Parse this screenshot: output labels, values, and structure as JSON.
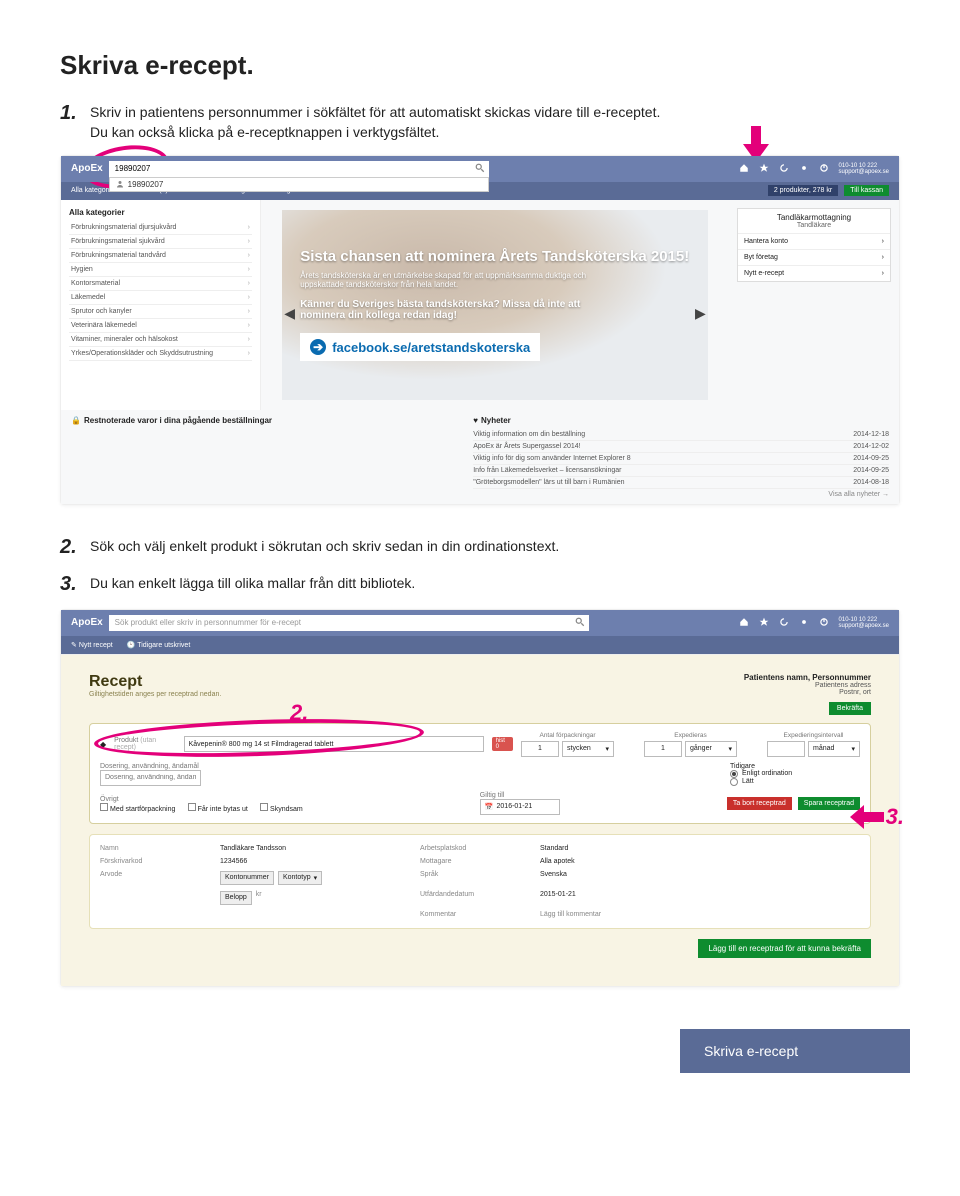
{
  "title": "Skriva e-recept.",
  "step1": {
    "num": "1.",
    "text1": "Skriv in patientens personnummer i sökfältet för att automatiskt skickas vidare till e-receptet.",
    "text2": "Du kan också klicka på e-receptknappen i verktygsfältet."
  },
  "step2": {
    "num": "2.",
    "text": "Sök och välj enkelt produkt i sökrutan och skriv sedan in din ordinationstext."
  },
  "step3": {
    "num": "3.",
    "text": "Du kan enkelt lägga till olika mallar från ditt bibliotek."
  },
  "shot1": {
    "logo": "ApoEx",
    "search_value": "19890207",
    "dropdown_value": "19890207",
    "contact_phone": "010-10 10 222",
    "contact_email": "support@apoex.se",
    "subbar_items": [
      "Alla kategorier",
      "Favoriter (0)",
      "Utlevererat",
      "Tidigare beställningar"
    ],
    "cart_text": "2 produkter, 278 kr",
    "cart_btn": "Till kassan",
    "cat_title": "Alla kategorier",
    "cats": [
      "Förbrukningsmaterial djursjukvård",
      "Förbrukningsmaterial sjukvård",
      "Förbrukningsmaterial tandvård",
      "Hygien",
      "Kontorsmaterial",
      "Läkemedel",
      "Sprutor och kanyler",
      "Veterinära läkemedel",
      "Vitaminer, mineraler och hälsokost",
      "Yrkes/Operationskläder och Skyddsutrustning"
    ],
    "hero_h1": "Sista chansen att nominera Årets Tandsköterska 2015!",
    "hero_p1": "Årets tandsköterska är en utmärkelse skapad för att uppmärksamma duktiga och uppskattade tandsköterskor från hela landet.",
    "hero_sub": "Känner du Sveriges bästa tandsköterska? Missa då inte att nominera din kollega redan idag!",
    "hero_fb": "facebook.se/aretstandskoterska",
    "r_title": "Tandläkarmottagning",
    "r_sub": "Tandläkare",
    "r_rows": [
      "Hantera konto",
      "Byt företag",
      "Nytt e-recept"
    ],
    "bsec_l_title": "Restnoterade varor i dina pågående beställningar",
    "bsec_r_title": "Nyheter",
    "news": [
      {
        "t": "Viktig information om din beställning",
        "d": "2014-12-18"
      },
      {
        "t": "ApoEx är Årets Supergassel 2014!",
        "d": "2014-12-02"
      },
      {
        "t": "Viktig info för dig som använder Internet Explorer 8",
        "d": "2014-09-25"
      },
      {
        "t": "Info från Läkemedelsverket – licensansökningar",
        "d": "2014-09-25"
      },
      {
        "t": "\"Gröteborgsmodellen\" lärs ut till barn i Rumänien",
        "d": "2014-08-18"
      }
    ],
    "news_link": "Visa alla nyheter →"
  },
  "shot2": {
    "logo": "ApoEx",
    "search_placeholder": "Sök produkt eller skriv in personnummer för e-recept",
    "contact_phone": "010-10 10 222",
    "contact_email": "support@apoex.se",
    "subbar_items": [
      "Nytt recept",
      "Tidigare utskrivet"
    ],
    "recept_title": "Recept",
    "recept_sub": "Giltighetstiden anges per receptrad nedan.",
    "patient_name": "Patientens namn, Personnummer",
    "patient_addr": "Patientens adress",
    "patient_post": "Postnr, ort",
    "bekr": "Bekräfta",
    "prod_label": "Produkt",
    "prod_sub": "(utan recept)",
    "prod_value": "Kåvepenin® 800 mg 14 st Filmdragerad tablett",
    "pill": "hist 0",
    "mid_cols": [
      {
        "lab": "Antal förpackningar",
        "val": "1",
        "unit": "stycken"
      },
      {
        "lab": "Expedieras",
        "val": "1",
        "unit": "gånger"
      },
      {
        "lab": "Expedieringsintervall",
        "val": "",
        "unit": "månad"
      }
    ],
    "desc_label": "Dosering, användning, ändamål",
    "desc_value": "Dosering, användning, ändamål...",
    "tidigare_label": "Tidigare",
    "radio1": "Enligt ordination",
    "radio2": "Lätt",
    "ovrigt_label": "Övrigt",
    "chk1": "Med startförpackning",
    "chk2": "Får inte bytas ut",
    "chk3": "Skyndsam",
    "giltig_label": "Giltig till",
    "giltig_val": "2016-01-21",
    "btn_del": "Ta bort receptrad",
    "btn_save": "Spara receptrad",
    "info": {
      "namn_l": "Namn",
      "namn_v": "Tandläkare Tandsson",
      "forsk_l": "Förskrivarkod",
      "forsk_v": "1234566",
      "arv_l": "Arvode",
      "arv_v_sel1": "Kontonummer",
      "arv_v_sel2": "Kontotyp",
      "bel_sel": "Belopp",
      "bel_unit": "kr",
      "arb_l": "Arbetsplatskod",
      "arb_v": "Standard",
      "mott_l": "Mottagare",
      "mott_v": "Alla apotek",
      "sprak_l": "Språk",
      "sprak_v": "Svenska",
      "utf_l": "Utfärdandedatum",
      "utf_v": "2015-01-21",
      "kom_l": "Kommentar",
      "kom_v": "Lägg till kommentar"
    },
    "final_btn": "Lägg till en receptrad för att kunna bekräfta"
  },
  "annotations": {
    "a2": "2.",
    "a3": "3."
  },
  "footer_tab": "Skriva e-recept"
}
